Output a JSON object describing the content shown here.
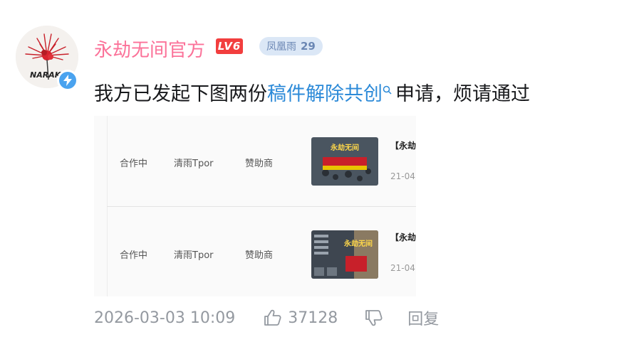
{
  "user": {
    "name": "永劫无间官方",
    "level_badge": "LV6",
    "fan_badge_name": "凤凰雨",
    "fan_badge_level": "29",
    "avatar_text": "NARAKA"
  },
  "comment": {
    "prefix": "我方已发起下图两份",
    "link_text": "稿件解除共创",
    "suffix": "申请，烦请通过"
  },
  "screenshot": {
    "rows": [
      {
        "status": "合作中",
        "creator": "清雨Tpor",
        "role": "赞助商",
        "thumb_title": "永劫无间",
        "video_title": "【永劫",
        "date": "21-04"
      },
      {
        "status": "合作中",
        "creator": "清雨Tpor",
        "role": "赞助商",
        "thumb_title": "永劫无间",
        "video_title": "【永劫",
        "date": "21-04"
      }
    ]
  },
  "footer": {
    "time": "2026-03-03 10:09",
    "likes": "37128",
    "reply_label": "回复"
  },
  "colors": {
    "username": "#fb7299",
    "link": "#2c8ad8",
    "meta": "#9499a0",
    "level_badge": "#f23e3e",
    "fan_badge_bg": "#dbe7f6",
    "verify": "#4aa3ef"
  },
  "icons": [
    "verified-lightning-icon",
    "search-icon",
    "thumbs-up-icon",
    "thumbs-down-icon"
  ]
}
